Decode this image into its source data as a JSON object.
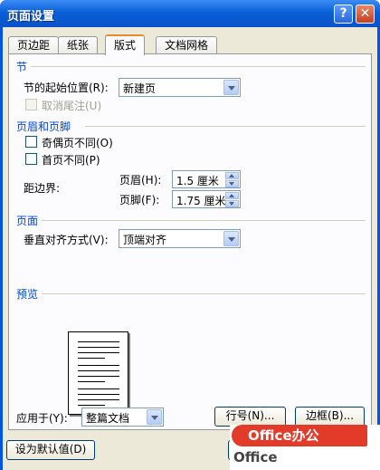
{
  "window": {
    "title": "页面设置",
    "help_label": "?",
    "close_label": "✕"
  },
  "tabs": [
    {
      "label": "页边距",
      "active": false
    },
    {
      "label": "纸张",
      "active": false
    },
    {
      "label": "版式",
      "active": true
    },
    {
      "label": "文档网格",
      "active": false
    }
  ],
  "section": {
    "header": "节",
    "start_label": "节的起始位置(R):",
    "start_value": "新建页",
    "suppress_endnotes_label": "取消尾注(U)",
    "suppress_endnotes_checked": false,
    "suppress_endnotes_enabled": false
  },
  "headers_footers": {
    "header": "页眉和页脚",
    "odd_even_label": "奇偶页不同(O)",
    "odd_even_checked": false,
    "first_page_label": "首页不同(P)",
    "first_page_checked": false,
    "from_edge_label": "距边界:",
    "header_label": "页眉(H):",
    "header_value": "1.5 厘米",
    "footer_label": "页脚(F):",
    "footer_value": "1.75 厘米"
  },
  "page": {
    "header": "页面",
    "valign_label": "垂直对齐方式(V):",
    "valign_value": "顶端对齐"
  },
  "preview": {
    "header": "预览"
  },
  "apply": {
    "label": "应用于(Y):",
    "value": "整篇文档"
  },
  "buttons": {
    "line_numbers": "行号(N)...",
    "borders": "边框(B)...",
    "set_default": "设为默认值(D)"
  },
  "watermark": {
    "line1": "Office办公",
    "line2": "Office"
  },
  "colors": {
    "titlebar": "#0a5fd8",
    "group_label": "#0046d5",
    "dialog_bg": "#ece9d8",
    "watermark_red": "#e23b2a"
  }
}
